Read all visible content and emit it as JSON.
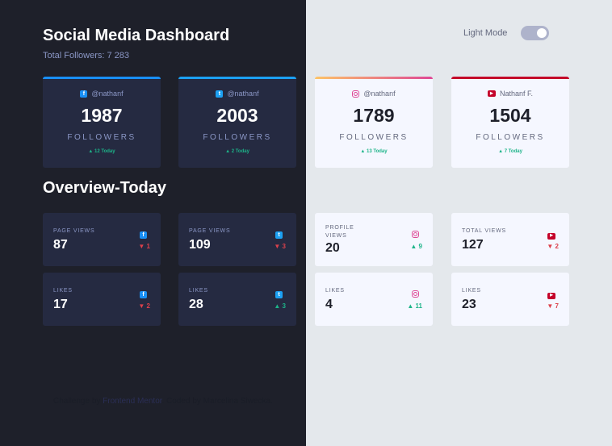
{
  "header": {
    "title": "Social Media Dashboard",
    "total_followers": "Total Followers: 7 283",
    "mode_label": "Light Mode"
  },
  "colors": {
    "dark_bg": "#1e202a",
    "light_bg": "#e4e8ec",
    "dark_card": "#252a41",
    "light_card": "#f5f7ff",
    "facebook": "#198ff5",
    "twitter": "#1ca0f2",
    "instagram_from": "#fdc468",
    "instagram_to": "#df4996",
    "youtube": "#c4032a",
    "up": "#1db489",
    "down": "#dc414c"
  },
  "followers": [
    {
      "platform": "facebook",
      "icon": "facebook-icon",
      "handle": "@nathanf",
      "count": "1987",
      "unit": "FOLLOWERS",
      "delta": "12 Today",
      "trend": "up"
    },
    {
      "platform": "twitter",
      "icon": "twitter-icon",
      "handle": "@nathanf",
      "count": "2003",
      "unit": "FOLLOWERS",
      "delta": "2 Today",
      "trend": "up"
    },
    {
      "platform": "instagram",
      "icon": "instagram-icon",
      "handle": "@nathanf",
      "count": "1789",
      "unit": "FOLLOWERS",
      "delta": "13 Today",
      "trend": "up"
    },
    {
      "platform": "youtube",
      "icon": "youtube-icon",
      "handle": "Nathanf F.",
      "count": "1504",
      "unit": "FOLLOWERS",
      "delta": "7 Today",
      "trend": "up"
    }
  ],
  "overview": {
    "title": "Overview-Today",
    "items": [
      {
        "label": "PAGE VIEWS",
        "platform": "facebook",
        "value": "87",
        "delta": "1",
        "trend": "down"
      },
      {
        "label": "PAGE VIEWS",
        "platform": "twitter",
        "value": "109",
        "delta": "3",
        "trend": "down"
      },
      {
        "label": "PROFILE VIEWS",
        "platform": "instagram",
        "value": "20",
        "delta": "9",
        "trend": "up"
      },
      {
        "label": "TOTAL VIEWS",
        "platform": "youtube",
        "value": "127",
        "delta": "2",
        "trend": "down"
      },
      {
        "label": "LIKES",
        "platform": "facebook",
        "value": "17",
        "delta": "2",
        "trend": "down"
      },
      {
        "label": "LIKES",
        "platform": "twitter",
        "value": "28",
        "delta": "3",
        "trend": "up"
      },
      {
        "label": "LIKES",
        "platform": "instagram",
        "value": "4",
        "delta": "11",
        "trend": "up"
      },
      {
        "label": "LIKES",
        "platform": "youtube",
        "value": "23",
        "delta": "7",
        "trend": "down"
      }
    ]
  },
  "footer": {
    "prefix": "Challenge by ",
    "link": "Frontend Mentor",
    "suffix": ". Coded by Marcelina Siwecka."
  }
}
